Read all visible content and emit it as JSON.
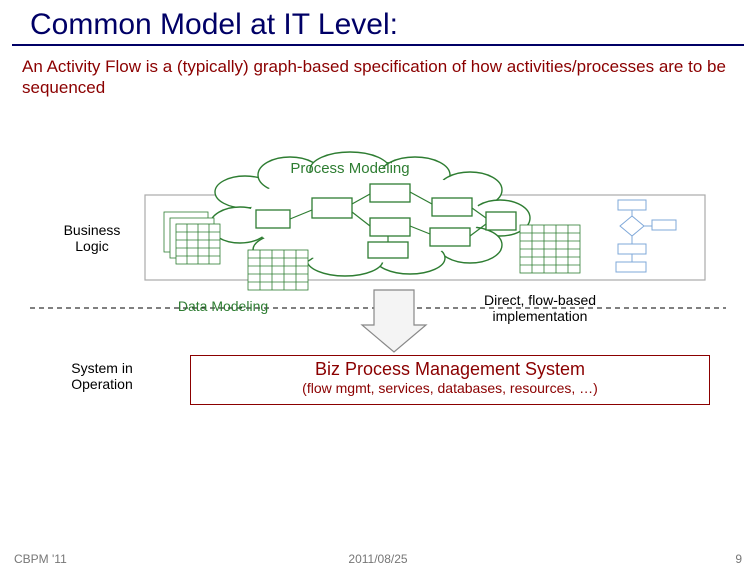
{
  "title": "Common Model at IT Level:",
  "description": "An Activity Flow is a (typically) graph-based specification of how activities/processes are to be sequenced",
  "labels": {
    "process_modeling": "Process Modeling",
    "business_logic": "Business\nLogic",
    "data_modeling": "Data Modeling",
    "direct_impl": "Direct, flow-based\nimplementation",
    "system_op": "System in\nOperation",
    "bpms_title": "Biz Process Management System",
    "bpms_sub": "(flow mgmt, services, databases, resources, …)"
  },
  "footer": {
    "left": "CBPM '11",
    "mid": "2011/08/25",
    "right": "9"
  },
  "colors": {
    "title": "#000066",
    "maroon": "#8b0000",
    "green": "#2e7d32",
    "lightblue": "#7fa8d9",
    "gray": "#888888"
  }
}
